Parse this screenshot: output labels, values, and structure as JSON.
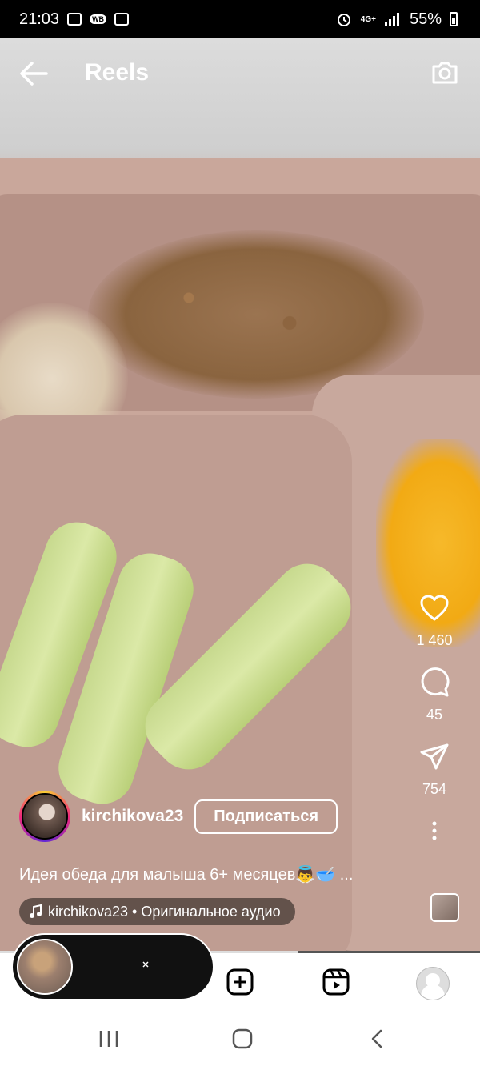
{
  "status_bar": {
    "time": "21:03",
    "network": "4G+",
    "battery": "55%",
    "left_icons": [
      "gallery-icon",
      "wb-icon",
      "media-icon"
    ],
    "right_icons": [
      "alarm-icon",
      "signal-icon",
      "battery-icon"
    ]
  },
  "header": {
    "title": "Reels",
    "back_icon": "back-arrow-icon",
    "camera_icon": "camera-icon"
  },
  "actions": {
    "likes": "1 460",
    "comments": "45",
    "shares": "754"
  },
  "author": {
    "username": "kirchikova23",
    "follow_label": "Подписаться"
  },
  "caption": "Идея обеда для малыша 6+ месяцев👼🥣 ...",
  "audio": {
    "label": "kirchikova23 • Оригинальное аудио"
  },
  "video_progress": 0.62,
  "bottom_nav": [
    "create-icon",
    "reels-icon",
    "profile-icon"
  ],
  "system_nav": [
    "recents-icon",
    "home-icon",
    "back-icon"
  ]
}
